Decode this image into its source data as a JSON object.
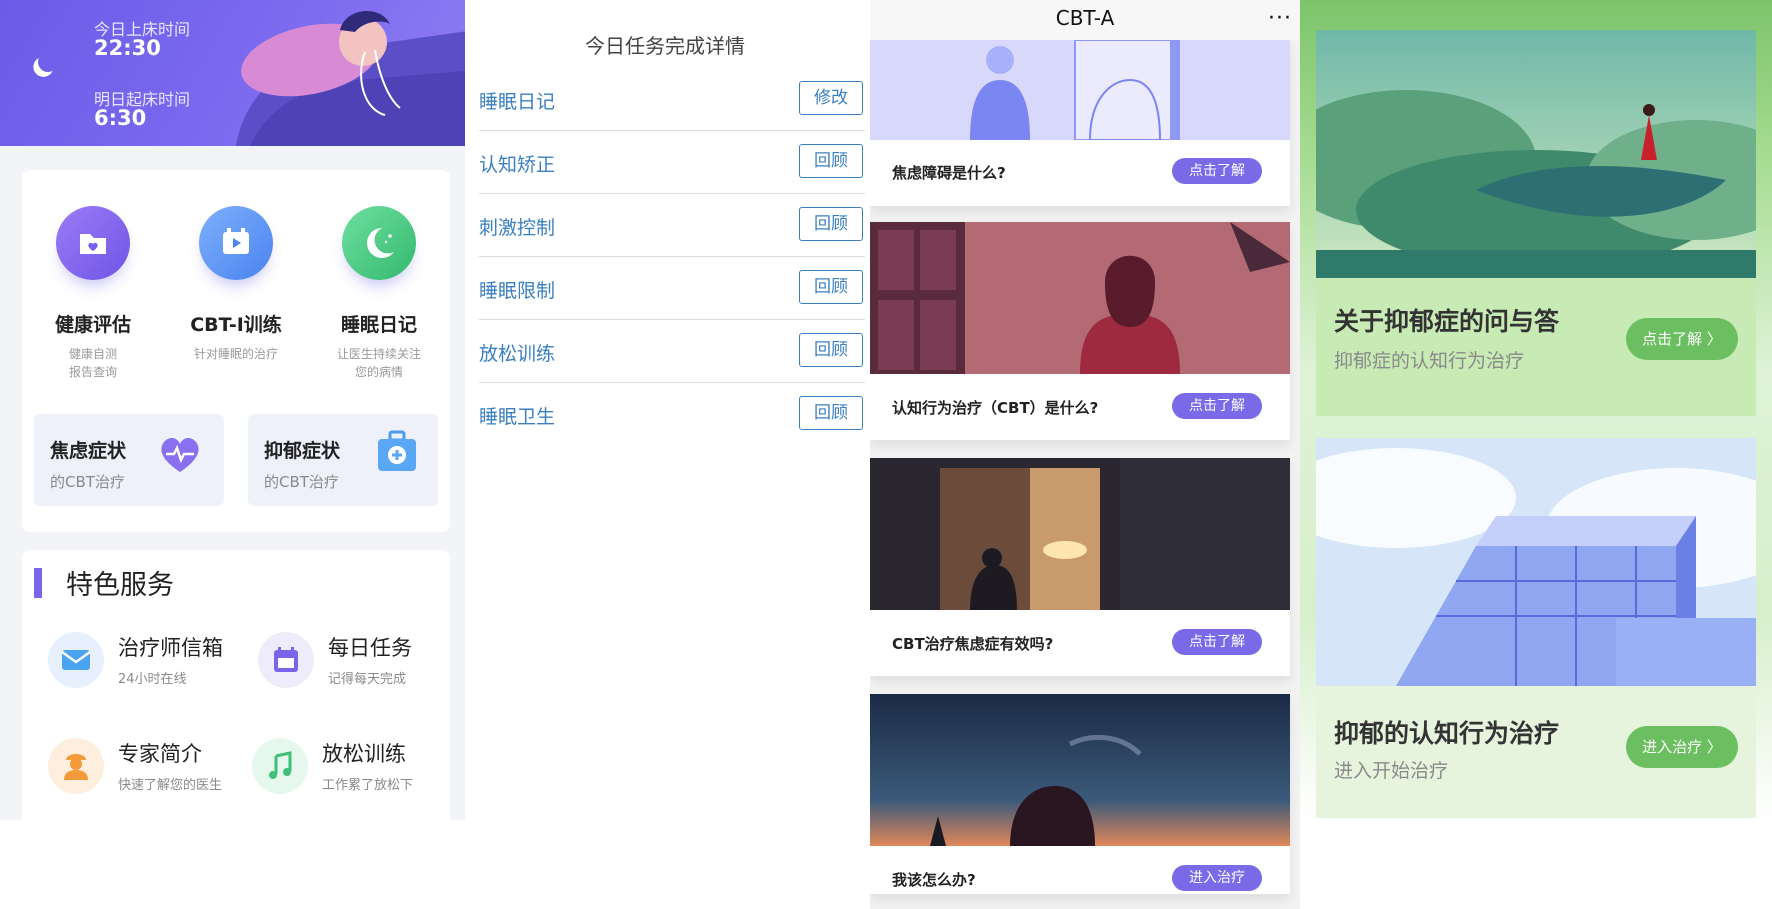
{
  "panel1": {
    "header": {
      "bedtime_label": "今日上床时间",
      "bedtime": "22:30",
      "wake_label": "明日起床时间",
      "wake": "6:30"
    },
    "features": [
      {
        "title": "健康评估",
        "sub1": "健康自测",
        "sub2": "报告查询",
        "icon": "folder-heart-icon"
      },
      {
        "title": "CBT-I训练",
        "sub1": "针对睡眠的治疗",
        "sub2": "",
        "icon": "video-icon"
      },
      {
        "title": "睡眠日记",
        "sub1": "让医生持续关注",
        "sub2": "您的病情",
        "icon": "moon-icon"
      }
    ],
    "symptoms": [
      {
        "title": "焦虑症状",
        "sub": "的CBT治疗",
        "icon": "heart-pulse-icon"
      },
      {
        "title": "抑郁症状",
        "sub": "的CBT治疗",
        "icon": "medical-kit-icon"
      }
    ],
    "services_title": "特色服务",
    "services": [
      {
        "title": "治疗师信箱",
        "sub": "24小时在线",
        "icon": "mail-icon"
      },
      {
        "title": "每日任务",
        "sub": "记得每天完成",
        "icon": "calendar-icon"
      },
      {
        "title": "专家简介",
        "sub": "快速了解您的医生",
        "icon": "doctor-icon"
      },
      {
        "title": "放松训练",
        "sub": "工作累了放松下",
        "icon": "music-icon"
      }
    ],
    "colors": {
      "primary": "#6a5ce8",
      "accent_bar": "#7a64ea"
    }
  },
  "panel2": {
    "title": "今日任务完成详情",
    "tasks": [
      {
        "label": "睡眠日记",
        "button": "修改"
      },
      {
        "label": "认知矫正",
        "button": "回顾"
      },
      {
        "label": "刺激控制",
        "button": "回顾"
      },
      {
        "label": "睡眠限制",
        "button": "回顾"
      },
      {
        "label": "放松训练",
        "button": "回顾"
      },
      {
        "label": "睡眠卫生",
        "button": "回顾"
      }
    ],
    "colors": {
      "link": "#3a7fc0"
    }
  },
  "panel3": {
    "title": "CBT-A",
    "more": "···",
    "articles": [
      {
        "question": "焦虑障碍是什么?",
        "button": "点击了解"
      },
      {
        "question": "认知行为治疗（CBT）是什么?",
        "button": "点击了解"
      },
      {
        "question": "CBT治疗焦虑症有效吗?",
        "button": "点击了解"
      },
      {
        "question": "我该怎么办?",
        "button": "进入治疗"
      }
    ],
    "colors": {
      "button": "#7b6ae8"
    }
  },
  "panel4": {
    "cards": [
      {
        "title": "关于抑郁症的问与答",
        "sub": "抑郁症的认知行为治疗",
        "button": "点击了解 〉"
      },
      {
        "title": "抑郁的认知行为治疗",
        "sub": "进入开始治疗",
        "button": "进入治疗 〉"
      }
    ],
    "colors": {
      "button": "#6cbf60"
    }
  }
}
